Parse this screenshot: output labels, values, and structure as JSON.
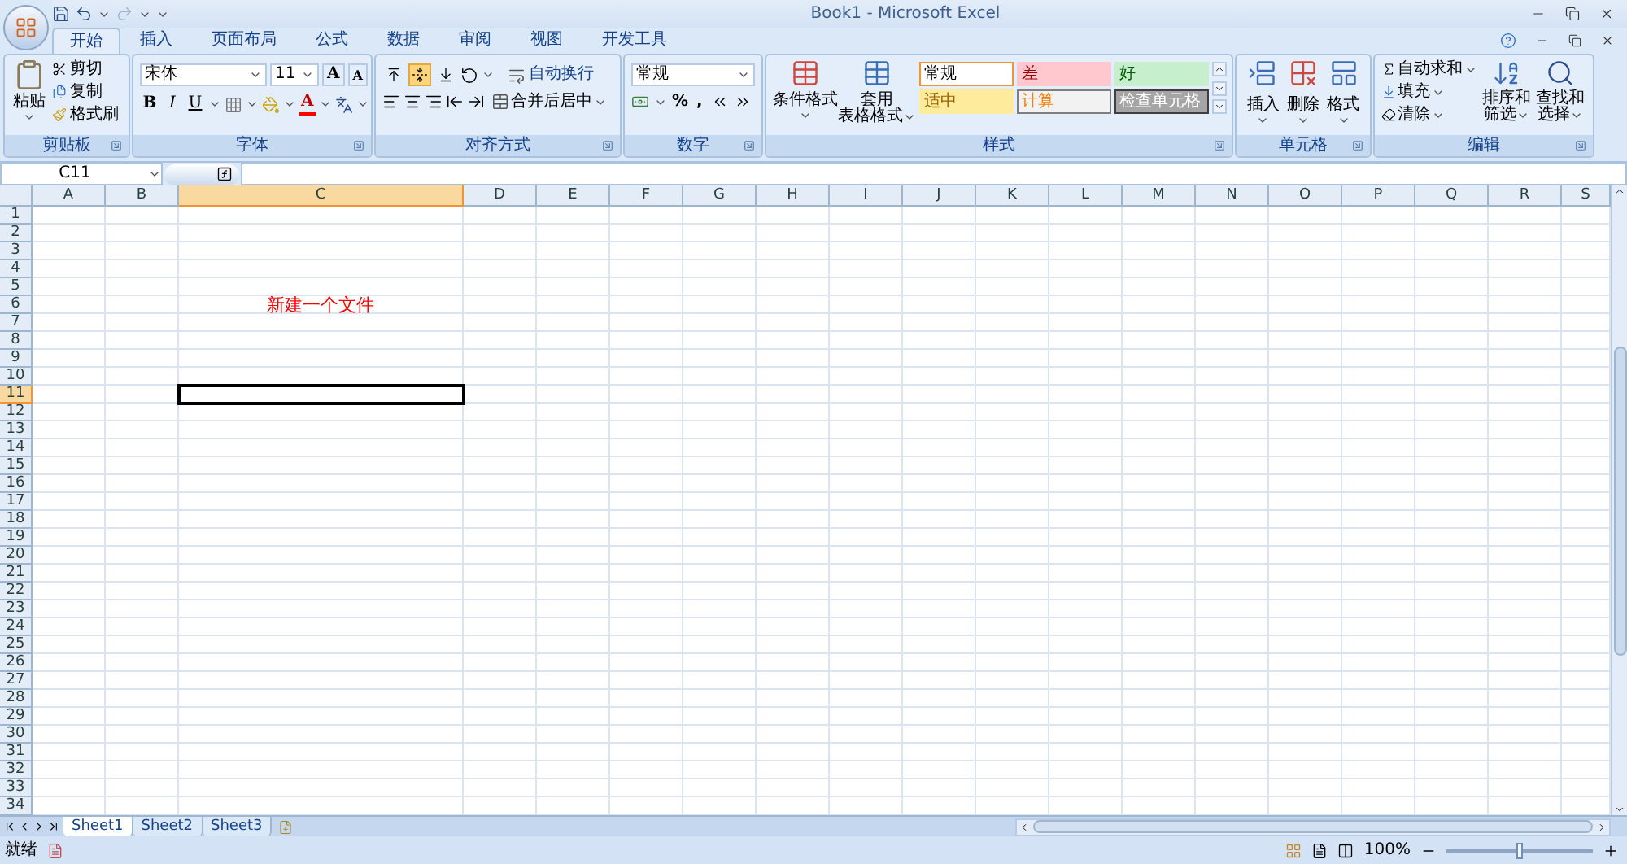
{
  "title_bar": {
    "title": "Book1 - Microsoft Excel"
  },
  "tabs": [
    {
      "label": "开始",
      "selected": true
    },
    {
      "label": "插入",
      "selected": false
    },
    {
      "label": "页面布局",
      "selected": false
    },
    {
      "label": "公式",
      "selected": false
    },
    {
      "label": "数据",
      "selected": false
    },
    {
      "label": "审阅",
      "selected": false
    },
    {
      "label": "视图",
      "selected": false
    },
    {
      "label": "开发工具",
      "selected": false
    }
  ],
  "ribbon": {
    "clipboard": {
      "name": "剪贴板",
      "paste": "粘贴",
      "items": [
        "剪切",
        "复制",
        "格式刷"
      ]
    },
    "font": {
      "name": "字体",
      "font": "宋体",
      "size": "11",
      "grow": "A",
      "shrink": "A",
      "bold": "B",
      "italic": "I",
      "underline": "U",
      "font_color": "A"
    },
    "alignment": {
      "name": "对齐方式",
      "vertical_buttons": [
        {
          "selected": false
        },
        {
          "selected": true
        },
        {
          "selected": false
        }
      ],
      "wrap": "自动换行",
      "merge": "合并后居中"
    },
    "number": {
      "name": "数字",
      "format": "常规",
      "percent": "%",
      "comma": ","
    },
    "styles": {
      "name": "样式",
      "conditional": "条件格式",
      "table_format_1": "套用",
      "table_format_2": "表格格式",
      "cell_styles": [
        {
          "label": "常规",
          "kind": "normal"
        },
        {
          "label": "适中",
          "kind": "neutral"
        },
        {
          "label": "差",
          "kind": "bad"
        },
        {
          "label": "计算",
          "kind": "calculation"
        },
        {
          "label": "好",
          "kind": "good"
        },
        {
          "label": "检查单元格",
          "kind": "check"
        }
      ]
    },
    "cells": {
      "name": "单元格",
      "buttons": [
        "插入",
        "删除",
        "格式"
      ]
    },
    "editing": {
      "name": "编辑",
      "items": [
        "自动求和",
        "填充",
        "清除"
      ],
      "sort_1": "排序和",
      "sort_2": "筛选",
      "find_1": "查找和",
      "find_2": "选择"
    }
  },
  "formula_bar": {
    "name_box": "C11"
  },
  "columns": [
    {
      "label": "A",
      "selected": false
    },
    {
      "label": "B",
      "selected": false
    },
    {
      "label": "C",
      "selected": true
    },
    {
      "label": "D",
      "selected": false
    },
    {
      "label": "E",
      "selected": false
    },
    {
      "label": "F",
      "selected": false
    },
    {
      "label": "G",
      "selected": false
    },
    {
      "label": "H",
      "selected": false
    },
    {
      "label": "I",
      "selected": false
    },
    {
      "label": "J",
      "selected": false
    },
    {
      "label": "K",
      "selected": false
    },
    {
      "label": "L",
      "selected": false
    },
    {
      "label": "M",
      "selected": false
    },
    {
      "label": "N",
      "selected": false
    },
    {
      "label": "O",
      "selected": false
    },
    {
      "label": "P",
      "selected": false
    },
    {
      "label": "Q",
      "selected": false
    },
    {
      "label": "R",
      "selected": false
    },
    {
      "label": "S",
      "selected": false
    }
  ],
  "rows": [
    {
      "label": "1",
      "selected": false
    },
    {
      "label": "2",
      "selected": false
    },
    {
      "label": "3",
      "selected": false
    },
    {
      "label": "4",
      "selected": false
    },
    {
      "label": "5",
      "selected": false
    },
    {
      "label": "6",
      "selected": false,
      "cells": {
        "C": {
          "text": "新建一个文件",
          "color": "#ff0000"
        }
      }
    },
    {
      "label": "7",
      "selected": false
    },
    {
      "label": "8",
      "selected": false
    },
    {
      "label": "9",
      "selected": false
    },
    {
      "label": "10",
      "selected": false
    },
    {
      "label": "11",
      "selected": true
    },
    {
      "label": "12",
      "selected": false
    },
    {
      "label": "13",
      "selected": false
    },
    {
      "label": "14",
      "selected": false
    },
    {
      "label": "15",
      "selected": false
    },
    {
      "label": "16",
      "selected": false
    },
    {
      "label": "17",
      "selected": false
    },
    {
      "label": "18",
      "selected": false
    },
    {
      "label": "19",
      "selected": false
    },
    {
      "label": "20",
      "selected": false
    },
    {
      "label": "21",
      "selected": false
    },
    {
      "label": "22",
      "selected": false
    },
    {
      "label": "23",
      "selected": false
    },
    {
      "label": "24",
      "selected": false
    },
    {
      "label": "25",
      "selected": false
    },
    {
      "label": "26",
      "selected": false
    },
    {
      "label": "27",
      "selected": false
    },
    {
      "label": "28",
      "selected": false
    },
    {
      "label": "29",
      "selected": false
    },
    {
      "label": "30",
      "selected": false
    },
    {
      "label": "31",
      "selected": false
    },
    {
      "label": "32",
      "selected": false
    },
    {
      "label": "33",
      "selected": false
    },
    {
      "label": "34",
      "selected": false
    }
  ],
  "sheet_tabs": [
    {
      "label": "Sheet1",
      "selected": true
    },
    {
      "label": "Sheet2",
      "selected": false
    },
    {
      "label": "Sheet3",
      "selected": false
    }
  ],
  "status_bar": {
    "status": "就绪",
    "zoom": "100%",
    "zoom_slider": {
      "level": 0.5
    }
  }
}
